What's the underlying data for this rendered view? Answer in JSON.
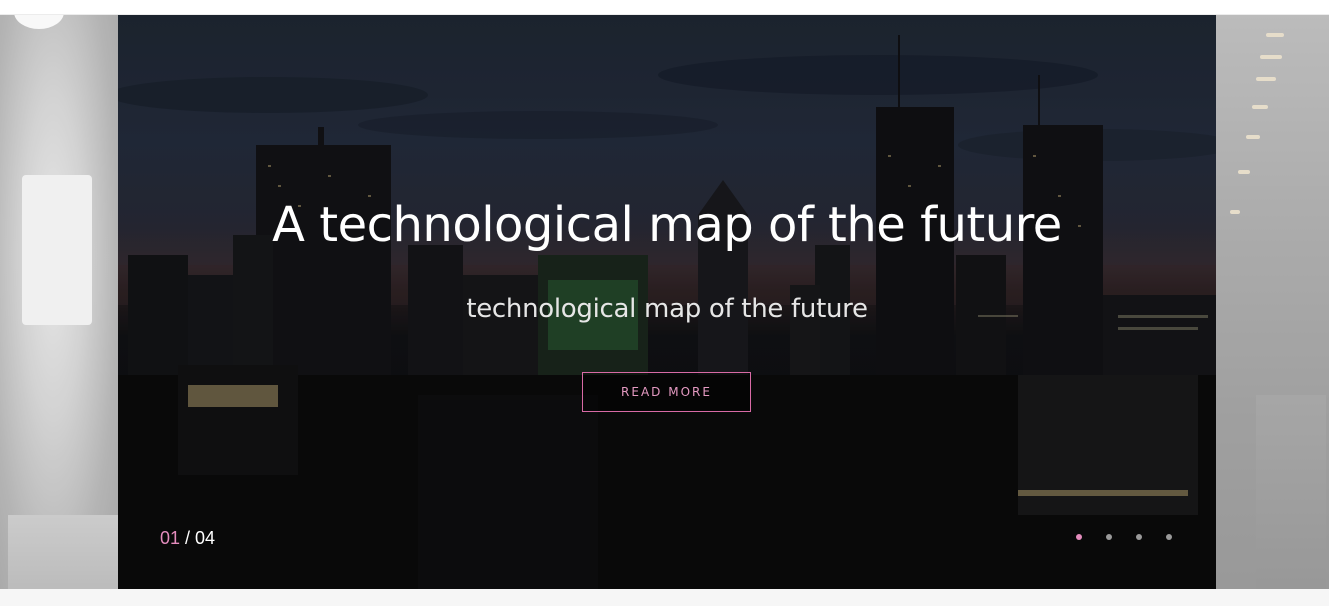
{
  "slider": {
    "title": "A technological map of the future",
    "subtitle": "technological map of the future",
    "button_label": "READ MORE",
    "counter": {
      "current": "01",
      "separator": " / ",
      "total": "04"
    },
    "dots": [
      {
        "active": true
      },
      {
        "active": false
      },
      {
        "active": false
      },
      {
        "active": false
      }
    ],
    "accent_color": "#e48cbd"
  }
}
